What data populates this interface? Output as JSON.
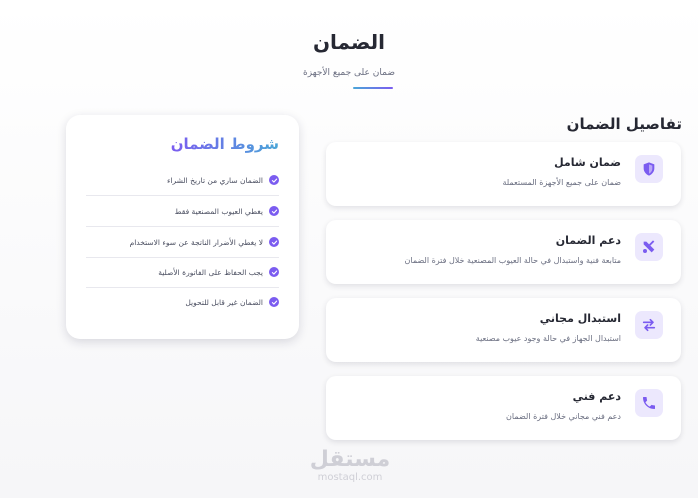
{
  "header": {
    "title": "الضمان",
    "subtitle": "ضمان على جميع الأجهزة"
  },
  "details": {
    "heading": "تفاصيل الضمان",
    "cards": [
      {
        "title": "ضمان شامل",
        "desc": "ضمان على جميع الأجهزة المستعملة",
        "icon": "shield-icon"
      },
      {
        "title": "دعم الضمان",
        "desc": "متابعة فنية واستبدال في حالة العيوب المصنعية خلال فترة الضمان",
        "icon": "tools-icon"
      },
      {
        "title": "استبدال مجاني",
        "desc": "استبدال الجهاز في حالة وجود عيوب مصنعية",
        "icon": "exchange-icon"
      },
      {
        "title": "دعم فني",
        "desc": "دعم فني مجاني خلال فترة الضمان",
        "icon": "phone-icon"
      }
    ]
  },
  "terms": {
    "heading": "شروط الضمان",
    "items": [
      "الضمان ساري من تاريخ الشراء",
      "يغطي العيوب المصنعية فقط",
      "لا يغطي الأضرار الناتجة عن سوء الاستخدام",
      "يجب الحفاظ على الفاتورة الأصلية",
      "الضمان غير قابل للتحويل"
    ]
  },
  "watermark": {
    "arabic": "مستقل",
    "latin": "mostaql.com"
  },
  "colors": {
    "accent": "#7b5cf0",
    "accent_light": "#ece8fd",
    "gradient_start": "#4aa6d8"
  }
}
